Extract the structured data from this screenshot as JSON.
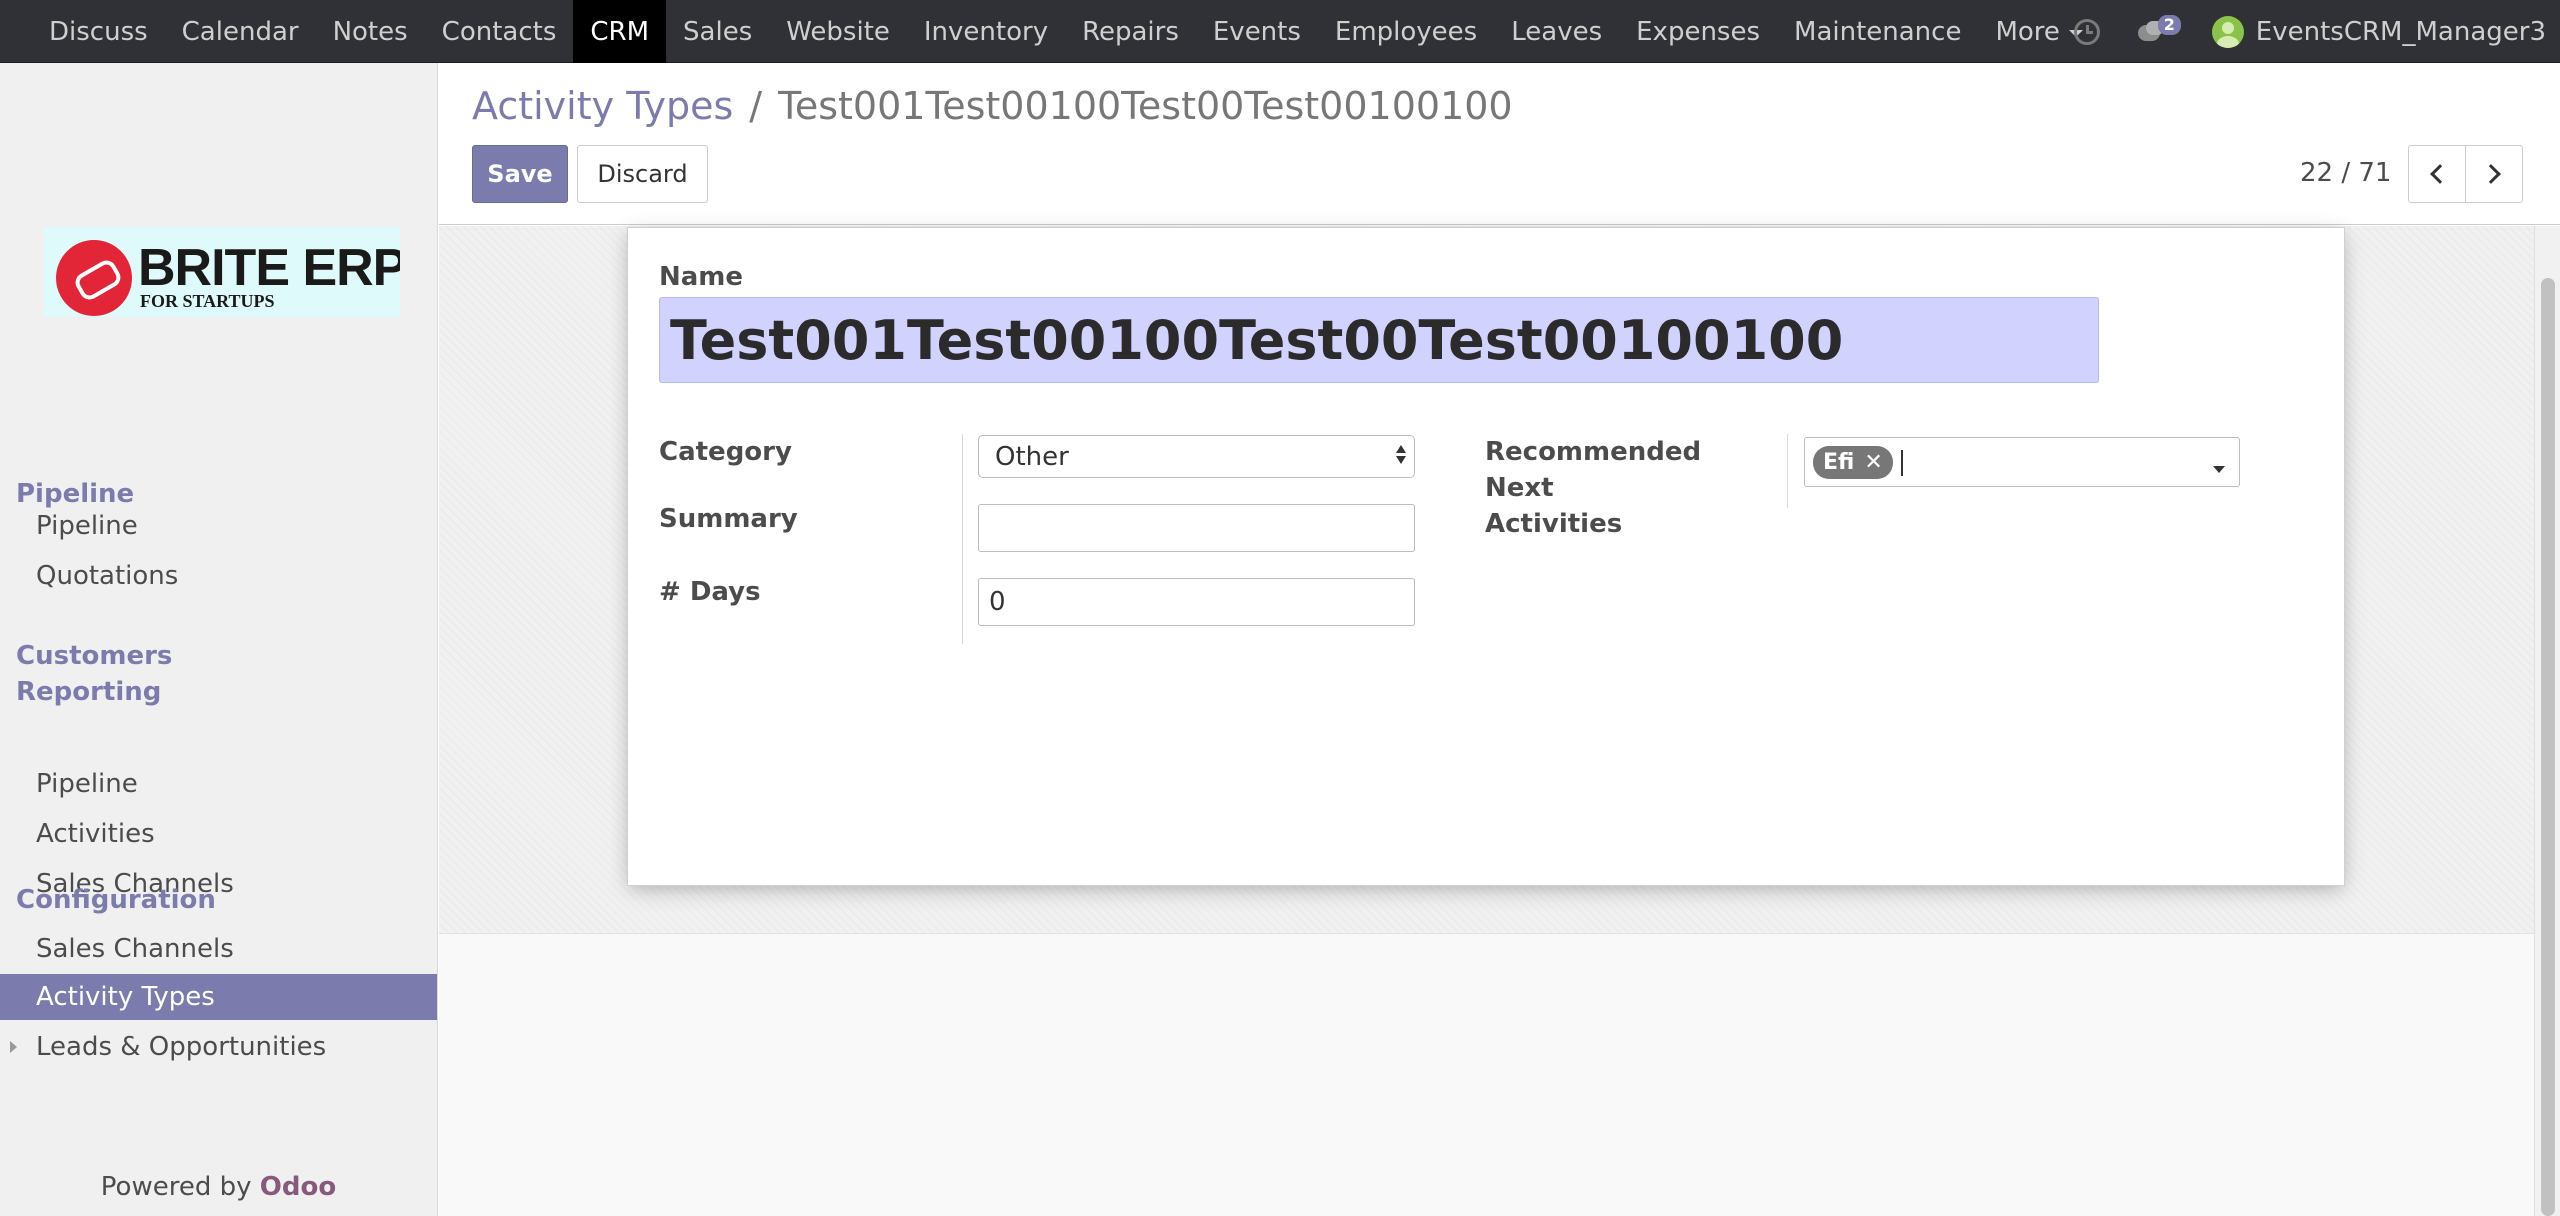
{
  "topbar": {
    "menu": [
      {
        "label": "Discuss"
      },
      {
        "label": "Calendar"
      },
      {
        "label": "Notes"
      },
      {
        "label": "Contacts"
      },
      {
        "label": "CRM",
        "active": true
      },
      {
        "label": "Sales"
      },
      {
        "label": "Website"
      },
      {
        "label": "Inventory"
      },
      {
        "label": "Repairs"
      },
      {
        "label": "Events"
      },
      {
        "label": "Employees"
      },
      {
        "label": "Leaves"
      },
      {
        "label": "Expenses"
      },
      {
        "label": "Maintenance"
      }
    ],
    "more_label": "More",
    "messages_count": "2",
    "user_name": "EventsCRM_Manager3"
  },
  "sidebar": {
    "logo_text": "BRITE ERP",
    "logo_subtext": "FOR STARTUPS",
    "sections": [
      {
        "title": "Pipeline",
        "items": [
          "Pipeline",
          "Quotations"
        ]
      },
      {
        "title": "Customers Reporting",
        "items": [
          "Pipeline",
          "Activities",
          "Sales Channels"
        ]
      },
      {
        "title": "Configuration",
        "items": [
          "Sales Channels",
          "Activity Types",
          "Leads & Opportunities"
        ]
      }
    ],
    "selected_item": "Activity Types",
    "powered_by": "Powered by",
    "powered_brand": "Odoo"
  },
  "control_panel": {
    "breadcrumb_parent": "Activity Types",
    "breadcrumb_separator": "/",
    "breadcrumb_current": "Test001Test00100Test00Test00100100",
    "save_label": "Save",
    "discard_label": "Discard",
    "pager": "22 / 71"
  },
  "form": {
    "name_label": "Name",
    "name_value": "Test001Test00100Test00Test00100100",
    "category_label": "Category",
    "category_value": "Other",
    "summary_label": "Summary",
    "summary_value": "",
    "days_label": "# Days",
    "days_value": "0",
    "next_activities_label_line1": "Recommended Next",
    "next_activities_label_line2": "Activities",
    "next_activities_tags": [
      "Efi"
    ]
  },
  "colors": {
    "brand": "#7c7bad",
    "navbar": "#2f3136",
    "name_field_bg": "#d2d2ff",
    "tag_bg": "#777777",
    "odoo": "#875a7b"
  }
}
